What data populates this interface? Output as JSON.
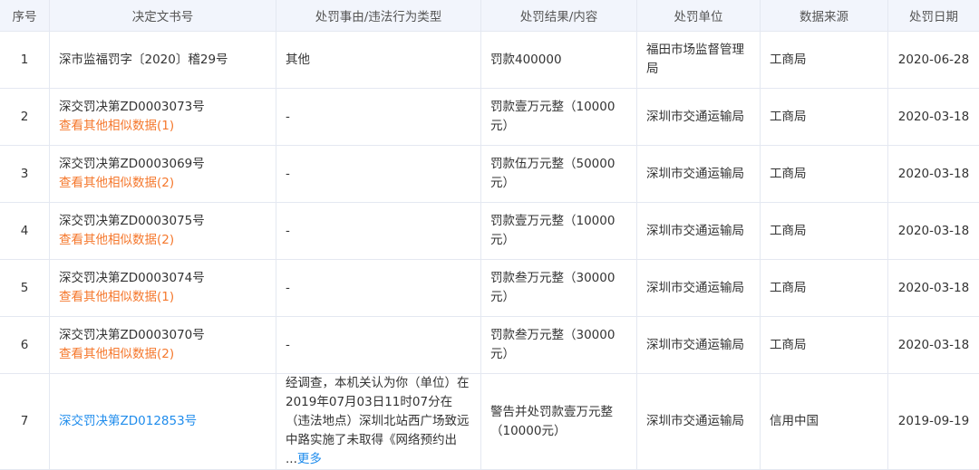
{
  "table": {
    "headers": [
      "序号",
      "决定文书号",
      "处罚事由/违法行为类型",
      "处罚结果/内容",
      "处罚单位",
      "数据来源",
      "处罚日期"
    ],
    "rows": [
      {
        "index": "1",
        "doc_no": "深市监福罚字〔2020〕稽29号",
        "similar": "",
        "reason": "其他",
        "result": "罚款400000",
        "unit": "福田市场监督管理局",
        "source": "工商局",
        "date": "2020-06-28"
      },
      {
        "index": "2",
        "doc_no": "深交罚决第ZD0003073号",
        "similar": "查看其他相似数据(1)",
        "reason": "-",
        "result": "罚款壹万元整（10000元）",
        "unit": "深圳市交通运输局",
        "source": "工商局",
        "date": "2020-03-18"
      },
      {
        "index": "3",
        "doc_no": "深交罚决第ZD0003069号",
        "similar": "查看其他相似数据(2)",
        "reason": "-",
        "result": "罚款伍万元整（50000元）",
        "unit": "深圳市交通运输局",
        "source": "工商局",
        "date": "2020-03-18"
      },
      {
        "index": "4",
        "doc_no": "深交罚决第ZD0003075号",
        "similar": "查看其他相似数据(2)",
        "reason": "-",
        "result": "罚款壹万元整（10000元）",
        "unit": "深圳市交通运输局",
        "source": "工商局",
        "date": "2020-03-18"
      },
      {
        "index": "5",
        "doc_no": "深交罚决第ZD0003074号",
        "similar": "查看其他相似数据(1)",
        "reason": "-",
        "result": "罚款叁万元整（30000元）",
        "unit": "深圳市交通运输局",
        "source": "工商局",
        "date": "2020-03-18"
      },
      {
        "index": "6",
        "doc_no": "深交罚决第ZD0003070号",
        "similar": "查看其他相似数据(2)",
        "reason": "-",
        "result": "罚款叁万元整（30000元）",
        "unit": "深圳市交通运输局",
        "source": "工商局",
        "date": "2020-03-18"
      },
      {
        "index": "7",
        "doc_no": "深交罚决第ZD012853号",
        "similar": "",
        "reason": "经调查，本机关认为你（单位）在2019年07月03日11时07分在（违法地点）深圳北站西广场致远中路实施了未取得《网络预约出 ...",
        "more": "更多",
        "result": "警告并处罚款壹万元整（10000元）",
        "unit": "深圳市交通运输局",
        "source": "信用中国",
        "date": "2019-09-19"
      }
    ]
  }
}
